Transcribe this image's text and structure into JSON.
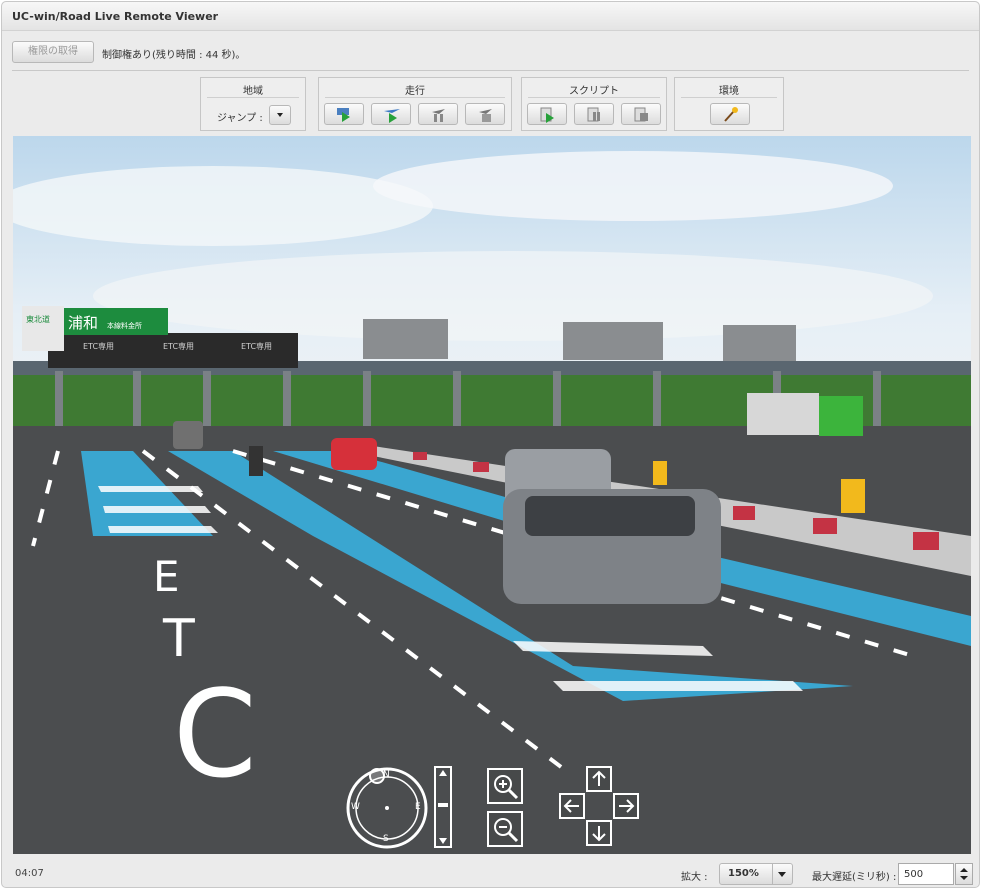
{
  "window": {
    "title": "UC-win/Road Live Remote Viewer"
  },
  "control": {
    "acquire_button": "権限の取得",
    "status": "制御権あり(残り時間 : 44 秒)。"
  },
  "toolbar": {
    "region": {
      "title": "地域",
      "jump_label": "ジャンプ :"
    },
    "drive": {
      "title": "走行",
      "buttons": [
        "drive-start-icon",
        "fly-start-icon",
        "drive-option-icon",
        "drive-stop-icon"
      ]
    },
    "script": {
      "title": "スクリプト",
      "buttons": [
        "script-play-icon",
        "script-pause-icon",
        "script-stop-icon"
      ]
    },
    "environment": {
      "title": "環境",
      "buttons": [
        "magic-wand-icon"
      ]
    }
  },
  "scene": {
    "sign_text": "浦和",
    "sign_sub": "本線料金所",
    "sign_badge": "東北道",
    "booth_labels": [
      "ETC専用",
      "ETC専用",
      "ETC専用"
    ],
    "road_marking": [
      "E",
      "T",
      "C"
    ]
  },
  "compass": {
    "labels": [
      "N",
      "E",
      "S",
      "W"
    ]
  },
  "footer": {
    "time": "04:07",
    "zoom_label": "拡大 :",
    "zoom_value": "150%",
    "delay_label": "最大遅延(ミリ秒) :",
    "delay_value": "500"
  },
  "colors": {
    "lane_blue": "#3aa6d0",
    "sign_green": "#1d8c3e",
    "sky": "#d6e8f4"
  }
}
